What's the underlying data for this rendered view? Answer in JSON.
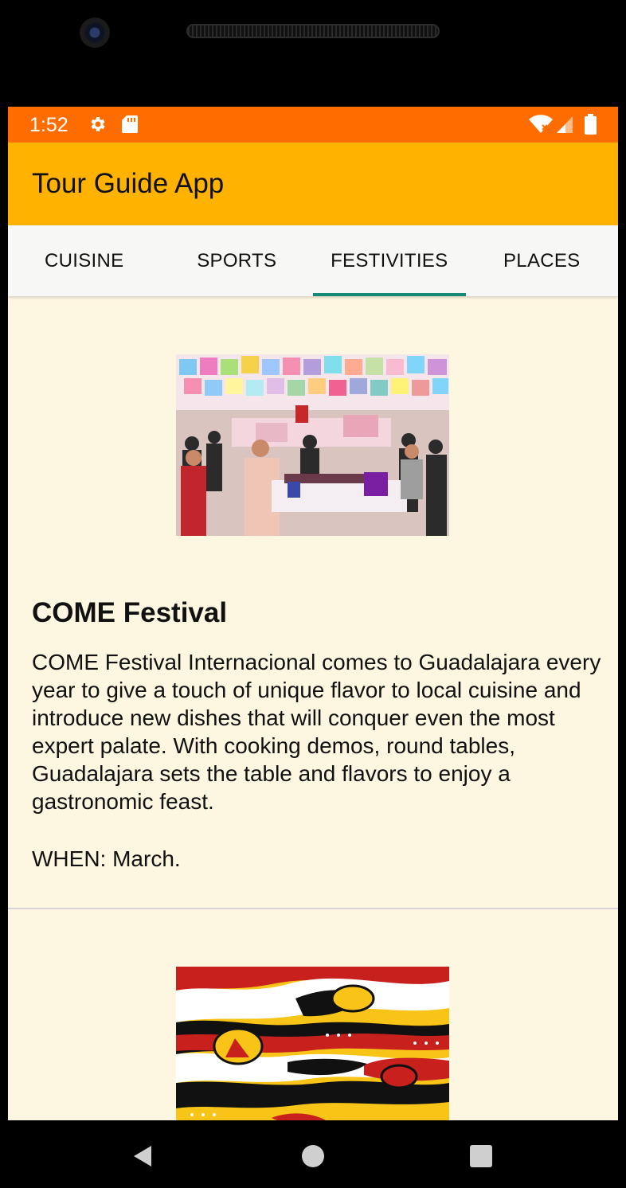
{
  "status_bar": {
    "time": "1:52",
    "icons": [
      "gear-icon",
      "sd-card-icon",
      "wifi-off-icon",
      "signal-icon",
      "battery-icon"
    ],
    "color": "#ff6d00"
  },
  "app_bar": {
    "title": "Tour Guide App",
    "color": "#ffb300"
  },
  "tabs": [
    {
      "label": "CUISINE",
      "active": false
    },
    {
      "label": "SPORTS",
      "active": false
    },
    {
      "label": "FESTIVITIES",
      "active": true
    },
    {
      "label": "PLACES",
      "active": false
    }
  ],
  "tab_indicator_color": "#148a77",
  "items": [
    {
      "title": "COME Festival",
      "description": "COME Festival Internacional comes to Guadalajara every year to give a touch of unique flavor to local cuisine and introduce new dishes that will conquer even the most expert palate. With cooking demos, round tables, Guadalajara sets the table and flavors to enjoy a gastronomic feast.",
      "when": "WHEN: March.",
      "image": "festival-crowd-photo"
    },
    {
      "image": "colorful-art-illustration"
    }
  ],
  "nav_bar": {
    "icons": [
      "back-icon",
      "home-icon",
      "recents-icon"
    ]
  }
}
